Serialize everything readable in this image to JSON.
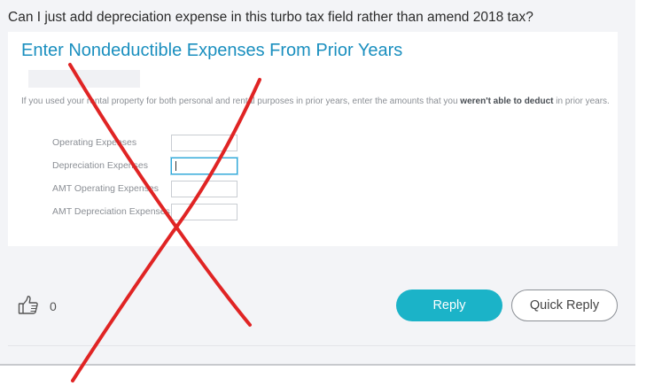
{
  "post": {
    "question": "Can I just add depreciation expense in this turbo tax field rather than amend 2018 tax?"
  },
  "screenshot": {
    "title": "Enter Nondeductible Expenses From Prior Years",
    "description_pre": "If you used your rental property for both personal and rental purposes in prior years, enter the amounts that you ",
    "description_bold": "weren't able to deduct",
    "description_post": " in prior years.",
    "fields": [
      {
        "label": "Operating Expenses",
        "value": ""
      },
      {
        "label": "Depreciation Expenses",
        "value": ""
      },
      {
        "label": "AMT Operating Expenses",
        "value": ""
      },
      {
        "label": "AMT Depreciation Expenses",
        "value": ""
      }
    ]
  },
  "actions": {
    "like_count": "0",
    "reply_label": "Reply",
    "quick_reply_label": "Quick Reply",
    "like_icon": "thumbs-up-icon"
  },
  "colors": {
    "accent": "#1bb3c8",
    "title_blue": "#1a8fbf",
    "annotation_red": "#e02424",
    "background": "#f3f4f7"
  }
}
